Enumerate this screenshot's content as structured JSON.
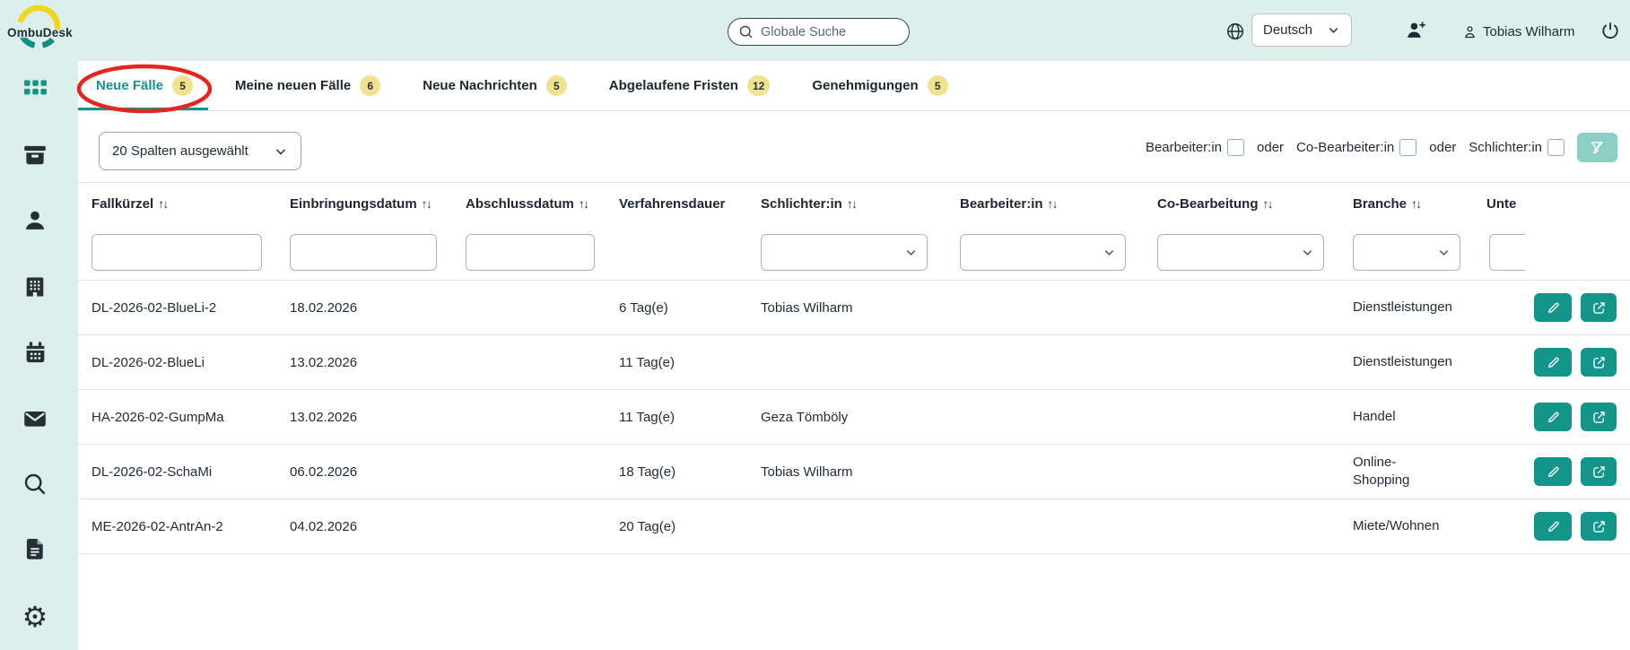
{
  "app": {
    "name": "OmbuDesk"
  },
  "topbar": {
    "search_placeholder": "Globale Suche",
    "language": "Deutsch",
    "user_name": "Tobias Wilharm"
  },
  "sidebar": {
    "items": [
      "apps-grid",
      "inbox",
      "person",
      "organization",
      "calendar",
      "mail",
      "search",
      "documents",
      "settings"
    ]
  },
  "tabs": [
    {
      "label": "Neue Fälle",
      "count": "5",
      "active": true
    },
    {
      "label": "Meine neuen Fälle",
      "count": "6",
      "active": false
    },
    {
      "label": "Neue Nachrichten",
      "count": "5",
      "active": false
    },
    {
      "label": "Abgelaufene Fristen",
      "count": "12",
      "active": false
    },
    {
      "label": "Genehmigungen",
      "count": "5",
      "active": false
    }
  ],
  "annotation": {
    "type": "ellipse",
    "target_tab": "Neue Fälle",
    "color": "#e52620"
  },
  "toolbar": {
    "columns_selected": "20 Spalten ausgewählt",
    "or_label": "oder",
    "filters": [
      "Bearbeiter:in",
      "Co-Bearbeiter:in",
      "Schlichter:in"
    ]
  },
  "table": {
    "sort_icon": "↑↓",
    "columns": [
      "Fallkürzel",
      "Einbringungsdatum",
      "Abschlussdatum",
      "Verfahrensdauer",
      "Schlichter:in",
      "Bearbeiter:in",
      "Co-Bearbeitung",
      "Branche",
      "Unte"
    ],
    "rows": [
      {
        "fallkuerzel": "DL-2026-02-BlueLi-2",
        "einbringungsdatum": "18.02.2026",
        "abschlussdatum": "",
        "verfahrensdauer": "6 Tag(e)",
        "schlichter": "Tobias Wilharm",
        "bearbeiter": "",
        "co_bearbeitung": "",
        "branche": "Dienstleistungen"
      },
      {
        "fallkuerzel": "DL-2026-02-BlueLi",
        "einbringungsdatum": "13.02.2026",
        "abschlussdatum": "",
        "verfahrensdauer": "11 Tag(e)",
        "schlichter": "",
        "bearbeiter": "",
        "co_bearbeitung": "",
        "branche": "Dienstleistungen"
      },
      {
        "fallkuerzel": "HA-2026-02-GumpMa",
        "einbringungsdatum": "13.02.2026",
        "abschlussdatum": "",
        "verfahrensdauer": "11 Tag(e)",
        "schlichter": "Geza Tömböly",
        "bearbeiter": "",
        "co_bearbeitung": "",
        "branche": "Handel"
      },
      {
        "fallkuerzel": "DL-2026-02-SchaMi",
        "einbringungsdatum": "06.02.2026",
        "abschlussdatum": "",
        "verfahrensdauer": "18 Tag(e)",
        "schlichter": "Tobias Wilharm",
        "bearbeiter": "",
        "co_bearbeitung": "",
        "branche": "Online-Shopping"
      },
      {
        "fallkuerzel": "ME-2026-02-AntrAn-2",
        "einbringungsdatum": "04.02.2026",
        "abschlussdatum": "",
        "verfahrensdauer": "20 Tag(e)",
        "schlichter": "",
        "bearbeiter": "",
        "co_bearbeitung": "",
        "branche": "Miete/Wohnen"
      }
    ]
  },
  "colors": {
    "accent_teal": "#14958a",
    "mint_background": "#ddefea",
    "badge_yellow": "#f1e290",
    "annotation_red": "#e52620",
    "logo_yellow": "#eed71e"
  }
}
